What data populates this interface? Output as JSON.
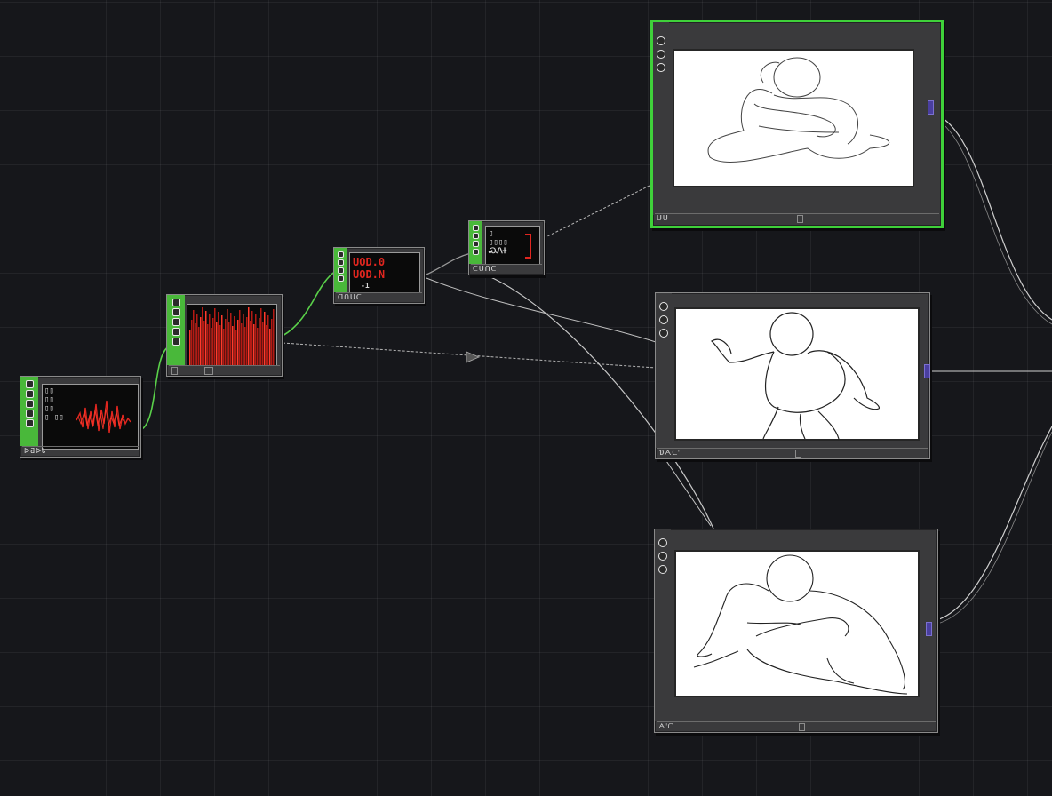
{
  "colors": {
    "background": "#16171b",
    "node_accent": "#49b83a",
    "selected_border": "#3fd13a",
    "signal_red": "#e0261f",
    "port": "#4a3fa0",
    "wire_green": "#5ad14a",
    "wire_gray": "#b5b5b5"
  },
  "nodes": {
    "waveform": {
      "status_label": "ᐅƋᐅᏓ",
      "side_icons": [
        "slot-icon",
        "slot-icon",
        "slot-icon",
        "slot-icon",
        "slot-icon"
      ],
      "readout_text": "▯▯\n▯▯\n▯▯\n▯ ▯▯"
    },
    "spectrum": {
      "status_label": "",
      "side_icons": [
        "slot-icon",
        "slot-icon",
        "slot-icon",
        "slot-icon",
        "slot-icon"
      ]
    },
    "counter": {
      "readout_line1": "UOD.0",
      "readout_line2": "UOD.N",
      "readout_line3": "-1",
      "status_label": "ᗡᑎᑌᑕ"
    },
    "display": {
      "readout": "▯\n▯▯▯▯\nᏍᏁᏐ",
      "status_label": "ᑕᑌᑎᑕ"
    },
    "preview_top": {
      "status_label": "ᑌᑌ",
      "selected": true
    },
    "preview_middle": {
      "status_label": "Ɗᗅᑕᑊ"
    },
    "preview_bottom": {
      "status_label": "ᗅᑊᗝ"
    }
  }
}
